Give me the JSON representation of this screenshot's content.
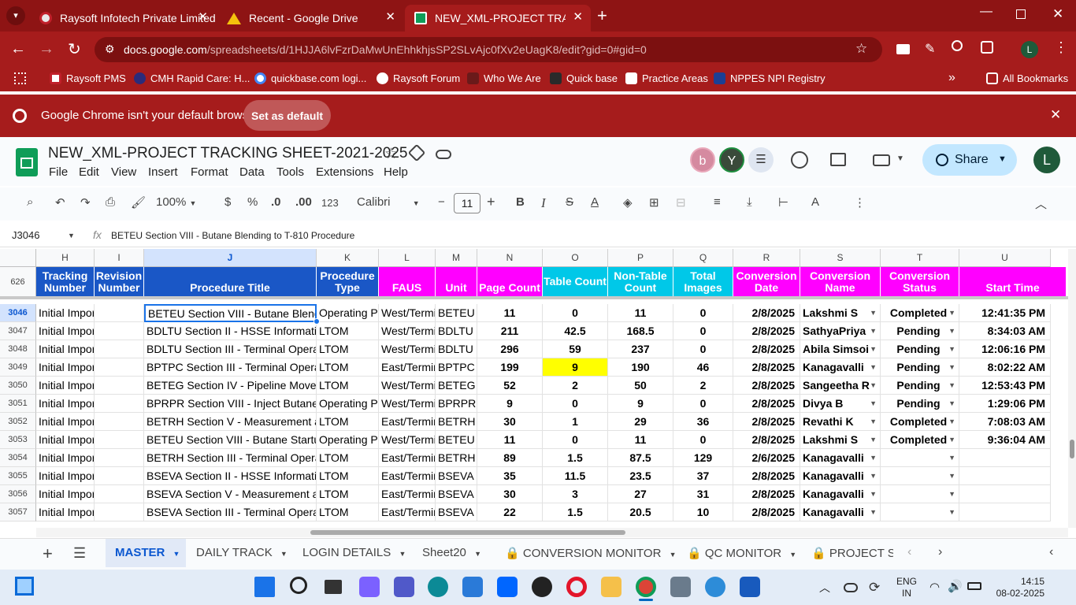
{
  "browser": {
    "tabs": [
      {
        "title": "Raysoft Infotech Private Limited"
      },
      {
        "title": "Recent - Google Drive"
      },
      {
        "title": "NEW_XML-PROJECT TRACKING"
      }
    ],
    "url_host": "docs.google.com",
    "url_path": "/spreadsheets/d/1HJJA6lvFzrDaMwUnEhhkhjsSP2SLvAjc0fXv2eUagK8/edit?gid=0#gid=0",
    "bookmarks": [
      "Raysoft PMS",
      "CMH Rapid Care: H...",
      "quickbase.com logi...",
      "Raysoft Forum",
      "Who We Are",
      "Quick base",
      "Practice Areas",
      "NPPES NPI Registry"
    ],
    "all_bookmarks": "All Bookmarks",
    "infobar_text": "Google Chrome isn't your default browser",
    "infobar_button": "Set as default",
    "profile_initial": "L"
  },
  "sheets": {
    "doc_title": "NEW_XML-PROJECT TRACKING SHEET-2021-2025",
    "menu": [
      "File",
      "Edit",
      "View",
      "Insert",
      "Format",
      "Data",
      "Tools",
      "Extensions",
      "Help"
    ],
    "avatars": [
      "b",
      "Y"
    ],
    "share_label": "Share",
    "account_initial": "L",
    "toolbar": {
      "zoom": "100%",
      "currency": "$",
      "percent": "%",
      "dec_down": ".0",
      "dec_up": ".00",
      "num_format": "123",
      "font": "Calibri",
      "font_size": "11"
    },
    "name_box": "J3046",
    "formula": "BETEU Section VIII - Butane Blending to T-810 Procedure",
    "frozen_label": "626",
    "columns": [
      "H",
      "I",
      "J",
      "K",
      "L",
      "M",
      "N",
      "O",
      "P",
      "Q",
      "R",
      "S",
      "T",
      "U"
    ],
    "headers": [
      "Tracking Number",
      "Revision Number",
      "Procedure Title",
      "Procedure Type",
      "FAUS",
      "Unit",
      "Page Count",
      "Table Count",
      "Non-Table Count",
      "Total Images",
      "Conversion Date",
      "Conversion Name",
      "Conversion Status",
      "Start Time"
    ],
    "rows": [
      {
        "num": "3046",
        "h": "Initial Impor",
        "j": "BETEU Section VIII - Butane Blending",
        "k": "Operating Pr",
        "l": "West/Termi",
        "m": "BETEU",
        "n": "11",
        "o": "0",
        "p": "11",
        "q": "0",
        "r": "2/8/2025",
        "s": "Lakshmi S",
        "t": "Completed",
        "u": "12:41:35 PM"
      },
      {
        "num": "3047",
        "h": "Initial Impor",
        "j": "BDLTU Section II - HSSE Information",
        "k": "LTOM",
        "l": "West/Termi",
        "m": "BDLTU",
        "n": "211",
        "o": "42.5",
        "p": "168.5",
        "q": "0",
        "r": "2/8/2025",
        "s": "SathyaPriya",
        "t": "Pending",
        "u": "8:34:03 AM"
      },
      {
        "num": "3048",
        "h": "Initial Impor",
        "j": "BDLTU Section III - Terminal Operatic",
        "k": "LTOM",
        "l": "West/Termi",
        "m": "BDLTU",
        "n": "296",
        "o": "59",
        "p": "237",
        "q": "0",
        "r": "2/8/2025",
        "s": "Abila Simsoi",
        "t": "Pending",
        "u": "12:06:16 PM"
      },
      {
        "num": "3049",
        "h": "Initial Impor",
        "j": "BPTPC Section III - Terminal Operatic",
        "k": "LTOM",
        "l": "East/Termir",
        "m": "BPTPC",
        "n": "199",
        "o": "9",
        "p": "190",
        "q": "46",
        "r": "2/8/2025",
        "s": "Kanagavalli",
        "t": "Pending",
        "u": "8:02:22 AM"
      },
      {
        "num": "3050",
        "h": "Initial Impor",
        "j": "BETEG Section IV - Pipeline Moveme",
        "k": "LTOM",
        "l": "West/Termi",
        "m": "BETEG",
        "n": "52",
        "o": "2",
        "p": "50",
        "q": "2",
        "r": "2/8/2025",
        "s": "Sangeetha R",
        "t": "Pending",
        "u": "12:53:43 PM"
      },
      {
        "num": "3051",
        "h": "Initial Impor",
        "j": "BPRPR Section VIII - Inject Butane fro",
        "k": "Operating Pr",
        "l": "West/Termi",
        "m": "BPRPR",
        "n": "9",
        "o": "0",
        "p": "9",
        "q": "0",
        "r": "2/8/2025",
        "s": "Divya B",
        "t": "Pending",
        "u": "1:29:06 PM"
      },
      {
        "num": "3052",
        "h": "Initial Impor",
        "j": "BETRH Section V - Measurement anc",
        "k": "LTOM",
        "l": "East/Termir",
        "m": "BETRH",
        "n": "30",
        "o": "1",
        "p": "29",
        "q": "36",
        "r": "2/8/2025",
        "s": "Revathi K",
        "t": "Completed",
        "u": "7:08:03 AM"
      },
      {
        "num": "3053",
        "h": "Initial Impor",
        "j": "BETEU Section VIII - Butane Startup /",
        "k": "Operating Pr",
        "l": "West/Termi",
        "m": "BETEU",
        "n": "11",
        "o": "0",
        "p": "11",
        "q": "0",
        "r": "2/8/2025",
        "s": "Lakshmi S",
        "t": "Completed",
        "u": "9:36:04 AM"
      },
      {
        "num": "3054",
        "h": "Initial Impor",
        "j": "BETRH Section III - Terminal Operatic",
        "k": "LTOM",
        "l": "East/Termir",
        "m": "BETRH",
        "n": "89",
        "o": "1.5",
        "p": "87.5",
        "q": "129",
        "r": "2/6/2025",
        "s": "Kanagavalli",
        "t": "",
        "u": ""
      },
      {
        "num": "3055",
        "h": "Initial Impor",
        "j": "BSEVA Section II - HSSE Information",
        "k": "LTOM",
        "l": "East/Termir",
        "m": "BSEVA",
        "n": "35",
        "o": "11.5",
        "p": "23.5",
        "q": "37",
        "r": "2/8/2025",
        "s": "Kanagavalli",
        "t": "",
        "u": ""
      },
      {
        "num": "3056",
        "h": "Initial Impor",
        "j": "BSEVA Section V - Measurement anc",
        "k": "LTOM",
        "l": "East/Termir",
        "m": "BSEVA",
        "n": "30",
        "o": "3",
        "p": "27",
        "q": "31",
        "r": "2/8/2025",
        "s": "Kanagavalli",
        "t": "",
        "u": ""
      },
      {
        "num": "3057",
        "h": "Initial Impor",
        "j": "BSEVA Section III - Terminal Operatic",
        "k": "LTOM",
        "l": "East/Termir",
        "m": "BSEVA",
        "n": "22",
        "o": "1.5",
        "p": "20.5",
        "q": "10",
        "r": "2/8/2025",
        "s": "Kanagavalli",
        "t": "",
        "u": ""
      }
    ],
    "sheet_tabs": [
      "MASTER",
      "DAILY TRACK",
      "LOGIN DETAILS",
      "Sheet20",
      "CONVERSION MONITOR",
      "QC MONITOR",
      "PROJECT SU"
    ]
  },
  "taskbar": {
    "lang": "ENG",
    "region": "IN",
    "time": "14:15",
    "date": "08-02-2025"
  },
  "colors": {
    "chrome_red": "#a61c1c",
    "header_blue": "#1a57c6",
    "header_magenta": "#ff00ff",
    "header_cyan": "#00c8e8",
    "highlight_yellow": "#ffff00"
  }
}
